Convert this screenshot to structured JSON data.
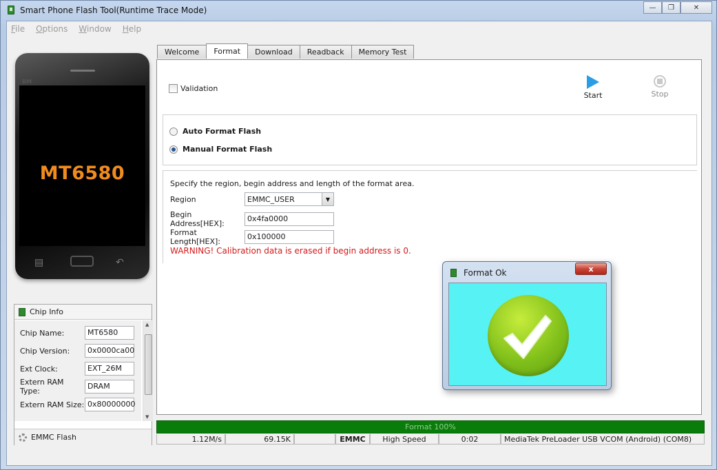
{
  "window": {
    "title": "Smart Phone Flash Tool(Runtime Trace Mode)"
  },
  "menu": [
    "File",
    "Options",
    "Window",
    "Help"
  ],
  "phone": {
    "brand": "BM",
    "model": "MT6580"
  },
  "chip_info": {
    "title": "Chip Info",
    "rows": [
      {
        "label": "Chip Name:",
        "value": "MT6580"
      },
      {
        "label": "Chip Version:",
        "value": "0x0000ca00"
      },
      {
        "label": "Ext Clock:",
        "value": "EXT_26M"
      },
      {
        "label": "Extern RAM Type:",
        "value": "DRAM"
      },
      {
        "label": "Extern RAM Size:",
        "value": "0x80000000"
      }
    ],
    "footer": "EMMC Flash"
  },
  "tabs": [
    "Welcome",
    "Format",
    "Download",
    "Readback",
    "Memory Test"
  ],
  "active_tab": "Format",
  "format": {
    "validation_label": "Validation",
    "start_label": "Start",
    "stop_label": "Stop",
    "auto_label": "Auto Format Flash",
    "manual_label": "Manual Format Flash",
    "selected_mode": "manual",
    "description": "Specify the region, begin address and length of the format area.",
    "region_label": "Region",
    "region_value": "EMMC_USER",
    "begin_label": "Begin Address[HEX]:",
    "begin_value": "0x4fa0000",
    "length_label": "Format Length[HEX]:",
    "length_value": "0x100000",
    "warning": "WARNING! Calibration data is erased if begin address is 0."
  },
  "dialog": {
    "title": "Format Ok",
    "close_label": "x",
    "background": "#57f3f4"
  },
  "progress": {
    "text": "Format 100%",
    "percent": 100,
    "color": "#0a7c0a"
  },
  "status": {
    "speed": "1.12M/s",
    "size": "69.15K",
    "blank": "",
    "storage": "EMMC",
    "mode": "High Speed",
    "time": "0:02",
    "port": "MediaTek PreLoader USB VCOM (Android) (COM8)"
  }
}
